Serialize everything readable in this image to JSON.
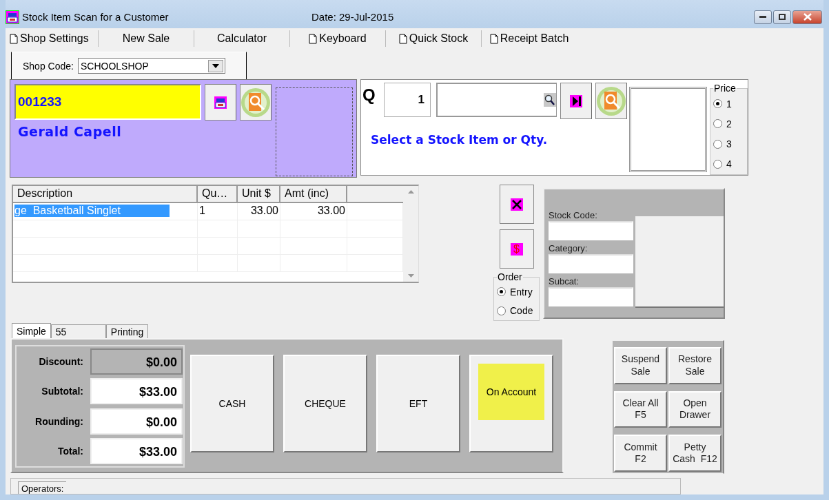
{
  "window": {
    "title": "Stock Item Scan for a Customer",
    "date": "Date: 29-Jul-2015"
  },
  "menu": [
    {
      "label": "Shop Settings",
      "has_icon": true
    },
    {
      "label": "New Sale",
      "has_icon": false
    },
    {
      "label": "Calculator",
      "has_icon": false
    },
    {
      "label": "Keyboard",
      "has_icon": true
    },
    {
      "label": "Quick Stock",
      "has_icon": true
    },
    {
      "label": "Receipt Batch",
      "has_icon": true
    }
  ],
  "shop_code": {
    "label": "Shop Code:",
    "value": "SCHOOLSHOP"
  },
  "customer": {
    "code": "001233",
    "name": "Gerald Capell"
  },
  "scan": {
    "q_label": "Q",
    "qty": "1",
    "message": "Select a Stock Item or Qty."
  },
  "price": {
    "title": "Price",
    "options": [
      {
        "label": "1",
        "selected": true
      },
      {
        "label": "2",
        "selected": false
      },
      {
        "label": "3",
        "selected": false
      },
      {
        "label": "4",
        "selected": false
      }
    ]
  },
  "table": {
    "columns": [
      "Description",
      "Qu…",
      "Unit $",
      "Amt (inc)"
    ],
    "rows": [
      {
        "cells": [
          "ge  Basketball Singlet",
          "1",
          "33.00",
          "33.00"
        ],
        "selected": true
      }
    ]
  },
  "price_button": {
    "glyph": "$"
  },
  "order": {
    "title": "Order",
    "options": [
      {
        "label": "Entry",
        "selected": true
      },
      {
        "label": "Code",
        "selected": false
      }
    ]
  },
  "stock_details": {
    "fields": [
      "Stock Code:",
      "Category:",
      "Subcat:"
    ]
  },
  "tabs": [
    {
      "label": "Simple",
      "selected": true
    },
    {
      "label": "55",
      "selected": false
    },
    {
      "label": "Printing",
      "selected": false
    }
  ],
  "totals": [
    {
      "label": "Discount:",
      "value": "$0.00",
      "readonly": true
    },
    {
      "label": "Subtotal:",
      "value": "$33.00",
      "readonly": false
    },
    {
      "label": "Rounding:",
      "value": "$0.00",
      "readonly": false
    },
    {
      "label": "Total:",
      "value": "$33.00",
      "readonly": false
    }
  ],
  "payments": [
    {
      "label": "CASH",
      "highlighted": false
    },
    {
      "label": "CHEQUE",
      "highlighted": false
    },
    {
      "label": "EFT",
      "highlighted": false
    },
    {
      "label": "On Account",
      "highlighted": true
    }
  ],
  "actions": [
    "Suspend\nSale",
    "Restore\nSale",
    "Clear All\nF5",
    "Open\nDrawer",
    "Commit\nF2",
    "Petty\nCash  F12"
  ],
  "status_bar": {
    "label": "Operators:"
  }
}
